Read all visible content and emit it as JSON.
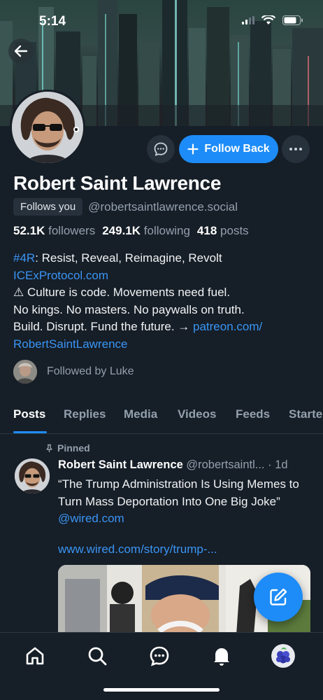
{
  "status_bar": {
    "time": "5:14"
  },
  "profile": {
    "name": "Robert Saint Lawrence",
    "follows_you": "Follows you",
    "handle": "@robertsaintlawrence.social",
    "follow_back_label": "Follow Back",
    "stats": {
      "followers_count": "52.1K",
      "followers_label": "followers",
      "following_count": "249.1K",
      "following_label": "following",
      "posts_count": "418",
      "posts_label": "posts"
    },
    "bio": {
      "hashtag": "#4R",
      "line1_rest": ": Resist, Reveal, Reimagine, Revolt",
      "site": "ICExProtocol.com",
      "line3": "⚠ Culture is code. Movements need fuel.",
      "line4": "No kings. No masters. No paywalls on truth.",
      "line5": "Build. Disrupt. Fund the future. → ",
      "patreon_link_a": "patreon.com/",
      "patreon_link_b": "RobertSaintLawrence"
    },
    "followed_by": "Followed by Luke"
  },
  "tabs": [
    "Posts",
    "Replies",
    "Media",
    "Videos",
    "Feeds",
    "Starter"
  ],
  "active_tab": "Posts",
  "post": {
    "pinned_label": "Pinned",
    "author": "Robert Saint Lawrence",
    "handle": "@robertsaintl...",
    "separator": " · ",
    "age": "1d",
    "text": "“The Trump Administration Is Using Memes to Turn Mass Deportation Into One Big Joke”",
    "mention": "@wired.com",
    "link": "www.wired.com/story/trump-..."
  },
  "bottom_nav": [
    {
      "icon": "home-icon"
    },
    {
      "icon": "search-icon"
    },
    {
      "icon": "chat-icon"
    },
    {
      "icon": "bell-icon"
    },
    {
      "icon": "profile-avatar"
    }
  ],
  "colors": {
    "accent": "#1d8cf8",
    "background": "#161e27",
    "link": "#3a95f5",
    "muted": "#93a0ad"
  }
}
